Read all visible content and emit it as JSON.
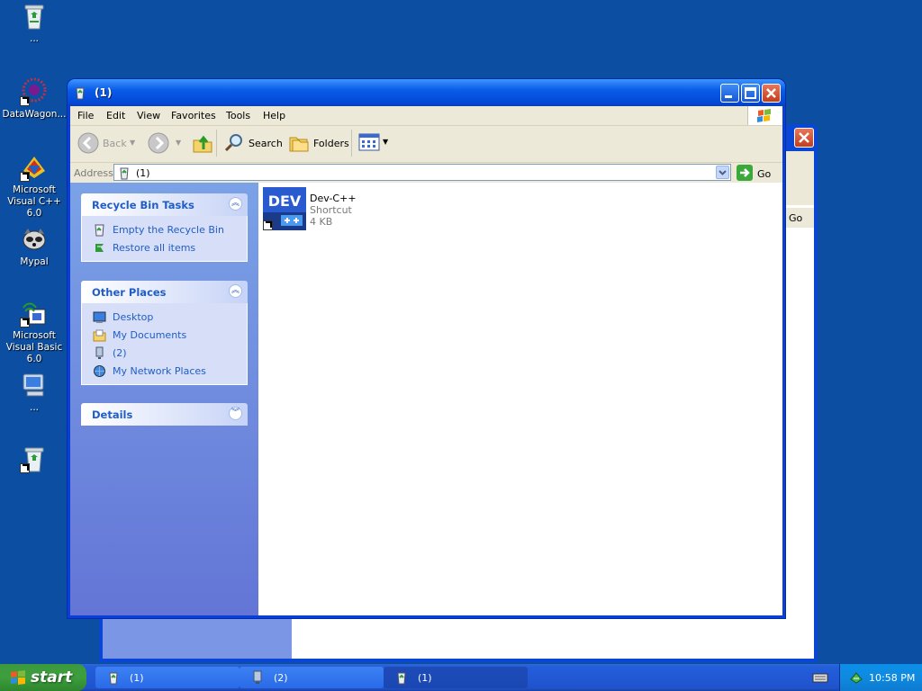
{
  "desktop": {
    "icons": [
      {
        "label": "..."
      },
      {
        "label": "DataWagon..."
      },
      {
        "label": "Microsoft Visual C++ 6.0"
      },
      {
        "label": "Mypal"
      },
      {
        "label": "Microsoft Visual Basic 6.0"
      },
      {
        "label": "..."
      },
      {
        "label": ""
      }
    ]
  },
  "back_window": {
    "go_label": "Go"
  },
  "window": {
    "title": "(1)",
    "menu": [
      "File",
      "Edit",
      "View",
      "Favorites",
      "Tools",
      "Help"
    ],
    "toolbar": {
      "back_label": "Back",
      "search_label": "Search",
      "folders_label": "Folders"
    },
    "address": {
      "label": "Address",
      "value": "(1)",
      "go_label": "Go"
    },
    "tasks": {
      "title": "Recycle Bin Tasks",
      "items": [
        "Empty the Recycle Bin",
        "Restore all items"
      ]
    },
    "other_places": {
      "title": "Other Places",
      "items": [
        "Desktop",
        "My Documents",
        "(2)",
        "My Network Places"
      ]
    },
    "details": {
      "title": "Details"
    },
    "file": {
      "name": "Dev-C++",
      "type": "Shortcut",
      "size": "4 KB",
      "icon_text": "DEV"
    }
  },
  "taskbar": {
    "start_label": "start",
    "buttons": [
      {
        "label": "(1)"
      },
      {
        "label": "(2)"
      },
      {
        "label": "(1)"
      }
    ],
    "clock": "10:58 PM"
  }
}
